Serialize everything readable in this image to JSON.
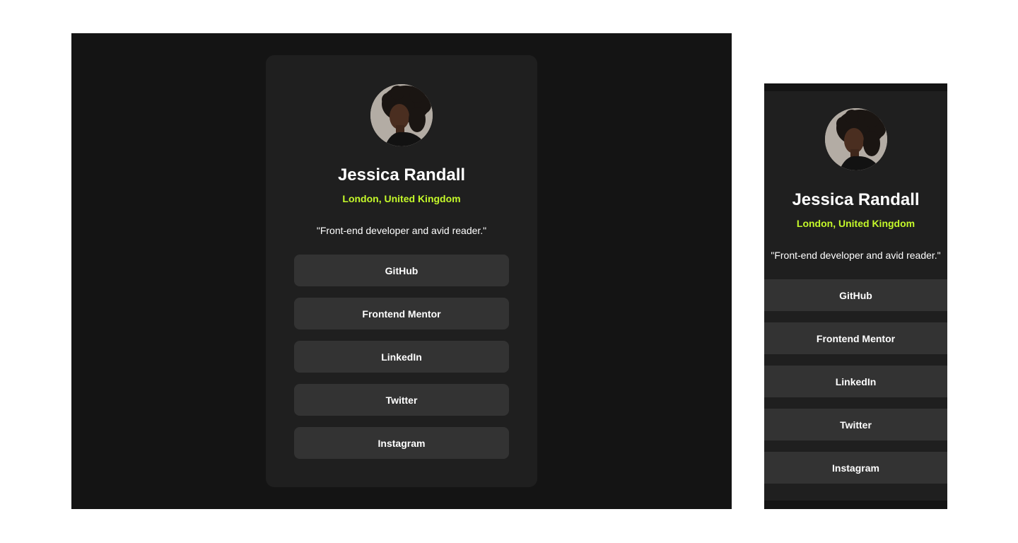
{
  "profile": {
    "name": "Jessica Randall",
    "location": "London, United Kingdom",
    "bio": "\"Front-end developer and avid reader.\"",
    "avatar_icon": "profile-photo"
  },
  "links": [
    {
      "label": "GitHub"
    },
    {
      "label": "Frontend Mentor"
    },
    {
      "label": "LinkedIn"
    },
    {
      "label": "Twitter"
    },
    {
      "label": "Instagram"
    }
  ],
  "colors": {
    "page_bg": "#141414",
    "card_bg": "#1f1f1f",
    "button_bg": "#333333",
    "accent": "#c4f82a",
    "text": "#ffffff"
  }
}
